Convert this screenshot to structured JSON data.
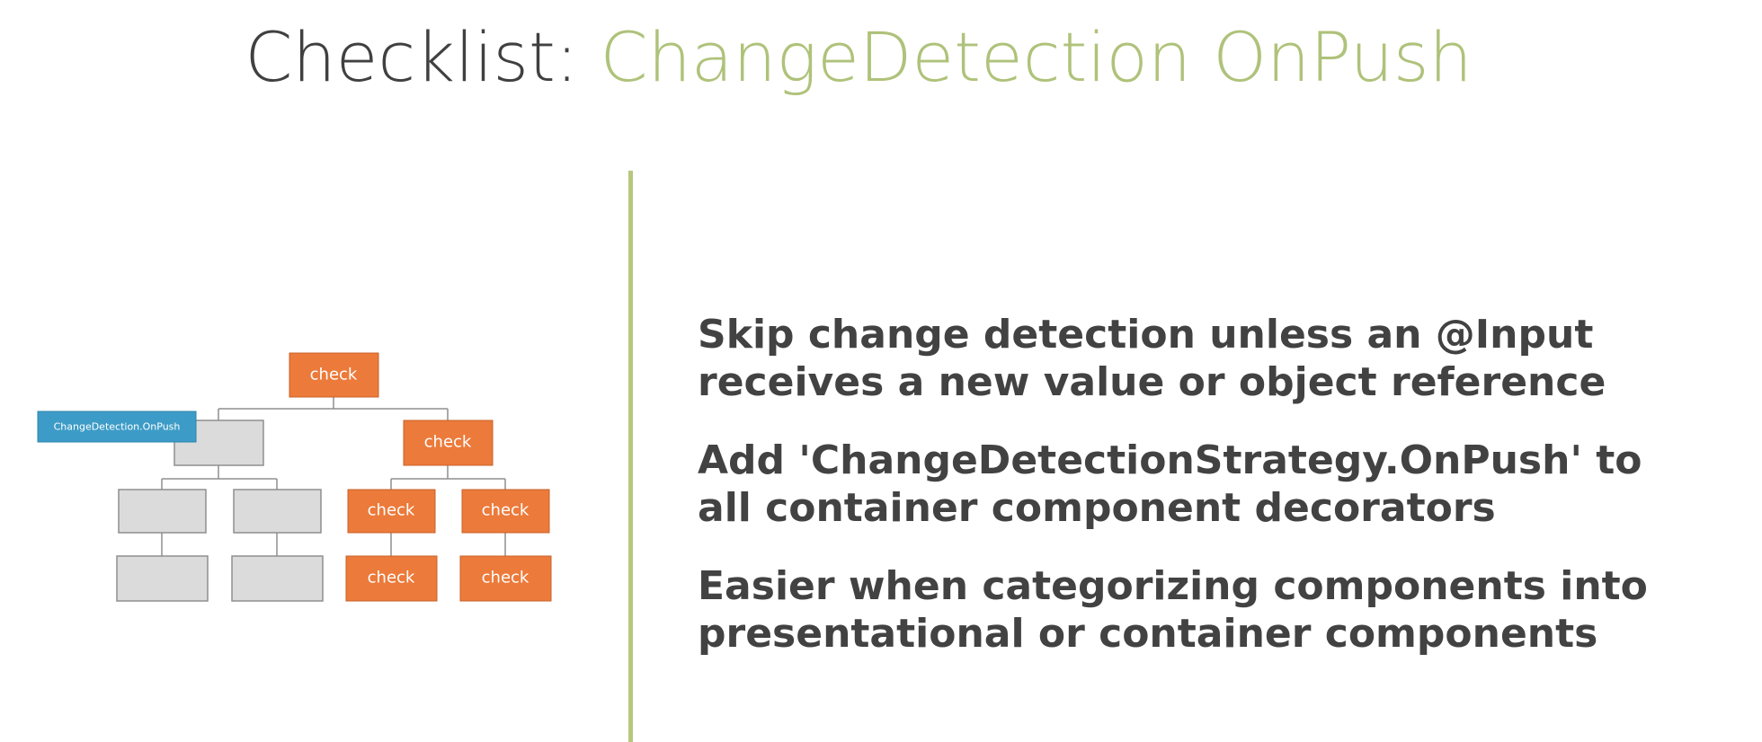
{
  "title": {
    "prefix": "Checklist:",
    "accent": "ChangeDetection OnPush"
  },
  "diagram": {
    "tag_label": "ChangeDetection.OnPush",
    "node_label": "check"
  },
  "bullets": [
    {
      "line1": "Skip change detection unless an @Input",
      "line2": "receives a new value or object reference"
    },
    {
      "line1": "Add 'ChangeDetectionStrategy.OnPush' to",
      "line2": "all container component decorators"
    },
    {
      "line1": "Easier when categorizing components into",
      "line2": "presentational or container components"
    }
  ],
  "colors": {
    "title_accent": "#afc27a",
    "divider": "#b7c77e",
    "check_node": "#ec7a3a",
    "onpush_tag": "#3d9cc7",
    "skipped_node": "#dbdbdb"
  }
}
